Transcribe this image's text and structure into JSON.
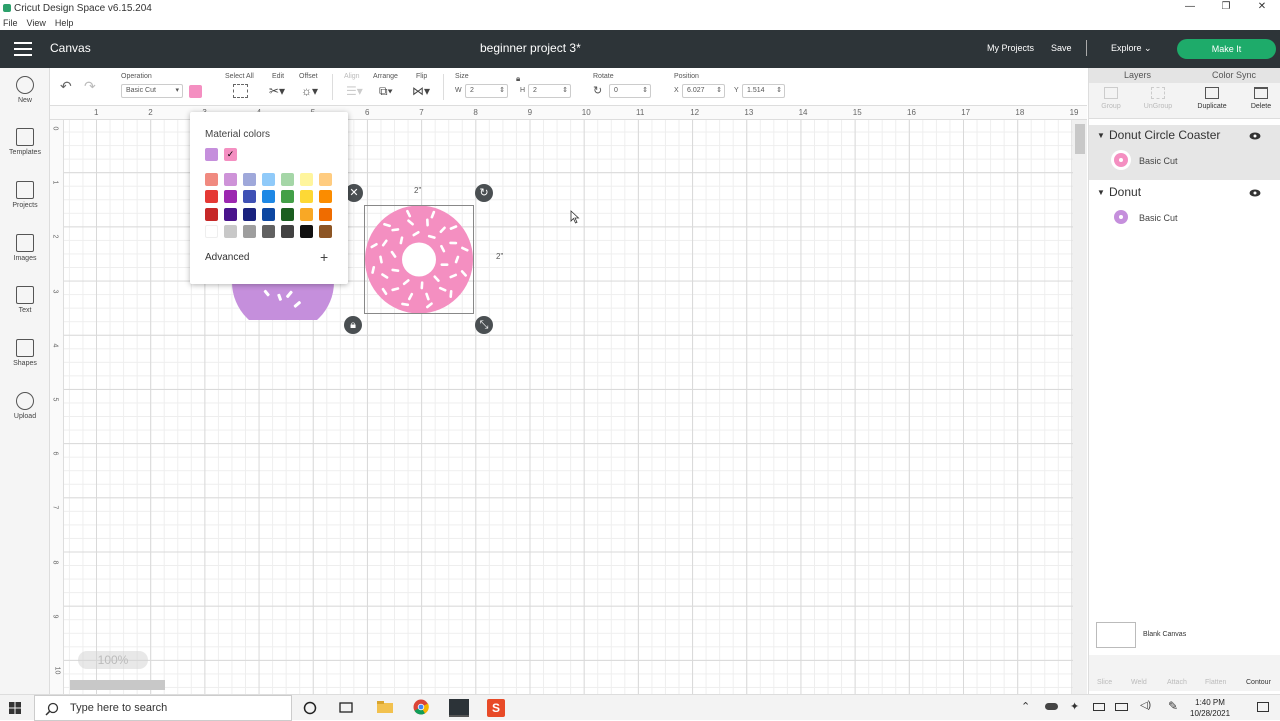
{
  "window": {
    "title": "Cricut Design Space  v6.15.204",
    "controls": [
      "—",
      "❐",
      "✕"
    ]
  },
  "menu": [
    "File",
    "View",
    "Help"
  ],
  "header": {
    "section": "Canvas",
    "project_title": "beginner project 3*",
    "my_projects": "My Projects",
    "save": "Save",
    "separator": "|",
    "explore": "Explore",
    "make_it": "Make It"
  },
  "toolbar": {
    "operation_label": "Operation",
    "operation_value": "Basic Cut",
    "select_all": "Select All",
    "edit": "Edit",
    "offset": "Offset",
    "align": "Align",
    "arrange": "Arrange",
    "flip": "Flip",
    "size_label": "Size",
    "w_label": "W",
    "w_value": "2",
    "h_label": "H",
    "h_value": "2",
    "rotate_label": "Rotate",
    "rotate_value": "0",
    "position_label": "Position",
    "x_label": "X",
    "x_value": "6.027",
    "y_label": "Y",
    "y_value": "1.514",
    "swatch_color": "#f48fc1"
  },
  "leftbar": [
    {
      "label": "New",
      "icon": "plus-circle-icon"
    },
    {
      "label": "Templates",
      "icon": "shirt-icon"
    },
    {
      "label": "Projects",
      "icon": "projects-icon"
    },
    {
      "label": "Images",
      "icon": "image-icon"
    },
    {
      "label": "Text",
      "icon": "text-icon"
    },
    {
      "label": "Shapes",
      "icon": "shapes-icon"
    },
    {
      "label": "Upload",
      "icon": "upload-cloud-icon"
    }
  ],
  "ruler": {
    "top": [
      "1",
      "2",
      "3",
      "4",
      "5",
      "6",
      "7",
      "8",
      "9",
      "10",
      "11",
      "12",
      "13",
      "14",
      "15",
      "16",
      "17",
      "18",
      "19"
    ],
    "left": [
      "0",
      "1",
      "2",
      "3",
      "4",
      "5",
      "6",
      "7",
      "8",
      "9",
      "10"
    ]
  },
  "canvas": {
    "zoom": "100%",
    "width_label": "2\"",
    "height_label": "2\""
  },
  "color_popup": {
    "title": "Material colors",
    "recent": [
      "#c58fdc",
      "#f48fc1"
    ],
    "palette": [
      [
        "#f08a80",
        "#ce93d8",
        "#9fa8da",
        "#90caf9",
        "#a5d6a7",
        "#fff59d",
        "#ffcc80"
      ],
      [
        "#e53935",
        "#9c27b0",
        "#3f51b5",
        "#1e88e5",
        "#43a047",
        "#fdd835",
        "#fb8c00"
      ],
      [
        "#c62828",
        "#4a148c",
        "#1a237e",
        "#0d47a1",
        "#1b5e20",
        "#f9a825",
        "#ef6c00"
      ],
      [
        "#ffffff",
        "#c8c8c8",
        "#9e9e9e",
        "#616161",
        "#424242",
        "#111111",
        "#8d5524"
      ]
    ],
    "advanced": "Advanced",
    "plus": "+"
  },
  "layers_panel": {
    "tab_layers": "Layers",
    "tab_color_sync": "Color Sync",
    "tools": [
      "Group",
      "UnGroup",
      "Duplicate",
      "Delete"
    ],
    "groups": [
      {
        "name": "Donut Circle Coaster",
        "layer": "Basic Cut",
        "color": "#f48fc1"
      },
      {
        "name": "Donut",
        "layer": "Basic Cut",
        "color": "#c58fdc"
      }
    ],
    "blank_canvas": "Blank Canvas",
    "bottom_tools": [
      "Slice",
      "Weld",
      "Attach",
      "Flatten",
      "Contour"
    ]
  },
  "taskbar": {
    "search_placeholder": "Type here to search",
    "time": "1:40 PM",
    "date": "10/28/2021"
  }
}
